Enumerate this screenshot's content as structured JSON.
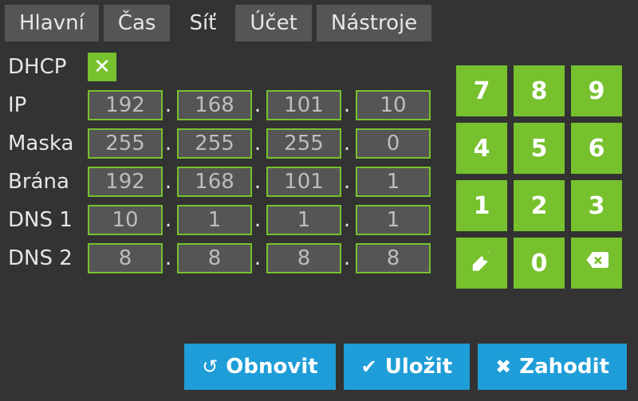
{
  "tabs": {
    "items": [
      {
        "label": "Hlavní",
        "active": false
      },
      {
        "label": "Čas",
        "active": false
      },
      {
        "label": "Síť",
        "active": true
      },
      {
        "label": "Účet",
        "active": false
      },
      {
        "label": "Nástroje",
        "active": false
      }
    ]
  },
  "form": {
    "dhcp": {
      "label": "DHCP",
      "checked": true,
      "glyph": "✕"
    },
    "ip": {
      "label": "IP",
      "o1": "192",
      "o2": "168",
      "o3": "101",
      "o4": "10"
    },
    "mask": {
      "label": "Maska",
      "o1": "255",
      "o2": "255",
      "o3": "255",
      "o4": "0"
    },
    "gw": {
      "label": "Brána",
      "o1": "192",
      "o2": "168",
      "o3": "101",
      "o4": "1"
    },
    "dns1": {
      "label": "DNS 1",
      "o1": "10",
      "o2": "1",
      "o3": "1",
      "o4": "1"
    },
    "dns2": {
      "label": "DNS 2",
      "o1": "8",
      "o2": "8",
      "o3": "8",
      "o4": "8"
    },
    "dot": "."
  },
  "keypad": {
    "k7": "7",
    "k8": "8",
    "k9": "9",
    "k4": "4",
    "k5": "5",
    "k6": "6",
    "k1": "1",
    "k2": "2",
    "k3": "3",
    "k0": "0"
  },
  "actions": {
    "refresh": {
      "label": "Obnovit"
    },
    "save": {
      "label": "Uložit"
    },
    "discard": {
      "label": "Zahodit"
    }
  },
  "colors": {
    "accent_green": "#76c12d",
    "accent_blue": "#1f9dd8",
    "bg": "#333333",
    "panel": "#555555"
  }
}
